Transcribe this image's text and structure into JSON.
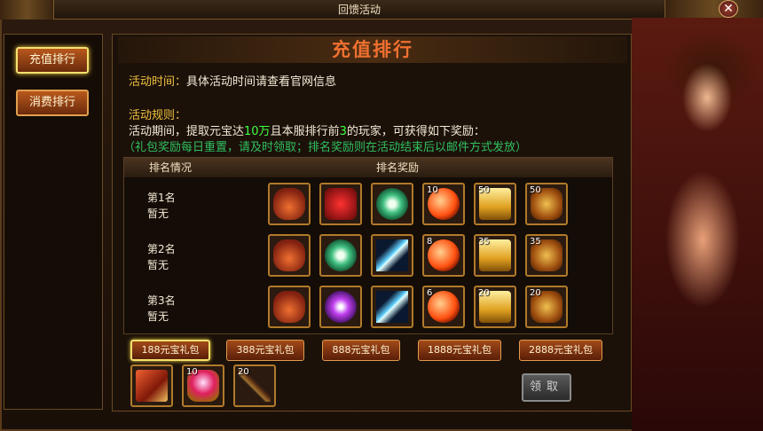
{
  "window_title": "回馈活动",
  "close_symbol": "✕",
  "sidebar": {
    "items": [
      {
        "label": "充值排行",
        "active": true
      },
      {
        "label": "消费排行",
        "active": false
      }
    ]
  },
  "main": {
    "heading": "充值排行",
    "time_label": "活动时间：",
    "time_text": "具体活动时间请查看官网信息",
    "rules_label": "活动规则：",
    "rules_part1": "活动期间，提取元宝达",
    "rules_amount": "10万",
    "rules_part2": "且本服排行前",
    "rules_rank": "3",
    "rules_part3": "的玩家，可获得如下奖励：",
    "rules_note": "（礼包奖励每日重置，请及时领取；排名奖励则在活动结束后以邮件方式发放）"
  },
  "table": {
    "col_rank": "排名情况",
    "col_reward": "排名奖励",
    "rows": [
      {
        "rank": "第1名",
        "holder": "暂无",
        "items": [
          {
            "icon": "fish-mount-icon",
            "count": ""
          },
          {
            "icon": "red-knot-icon",
            "count": ""
          },
          {
            "icon": "jade-disc-icon",
            "count": ""
          },
          {
            "icon": "fire-orb-icon",
            "count": "10"
          },
          {
            "icon": "gold-box-icon",
            "count": "50"
          },
          {
            "icon": "lion-medal-icon",
            "count": "50"
          }
        ]
      },
      {
        "rank": "第2名",
        "holder": "暂无",
        "items": [
          {
            "icon": "fish-mount-icon",
            "count": ""
          },
          {
            "icon": "jade-disc-icon",
            "count": ""
          },
          {
            "icon": "ice-sword-icon",
            "count": ""
          },
          {
            "icon": "fire-orb-icon",
            "count": "8"
          },
          {
            "icon": "gold-box-icon",
            "count": "35"
          },
          {
            "icon": "lion-medal-icon",
            "count": "35"
          }
        ]
      },
      {
        "rank": "第3名",
        "holder": "暂无",
        "items": [
          {
            "icon": "fish-mount-icon",
            "count": ""
          },
          {
            "icon": "purple-disc-icon",
            "count": ""
          },
          {
            "icon": "ice-sword-icon",
            "count": ""
          },
          {
            "icon": "fire-orb-icon",
            "count": "6"
          },
          {
            "icon": "gold-box-icon",
            "count": "20"
          },
          {
            "icon": "lion-medal-icon",
            "count": "20"
          }
        ]
      }
    ]
  },
  "packages": [
    {
      "label": "188元宝礼包",
      "active": true
    },
    {
      "label": "388元宝礼包",
      "active": false
    },
    {
      "label": "888元宝礼包",
      "active": false
    },
    {
      "label": "1888元宝礼包",
      "active": false
    },
    {
      "label": "2888元宝礼包",
      "active": false
    }
  ],
  "package_items": [
    {
      "icon": "red-book-icon",
      "count": ""
    },
    {
      "icon": "ruby-gem-icon",
      "count": "10"
    },
    {
      "icon": "whip-icon",
      "count": "20"
    }
  ],
  "claim_label": "领取"
}
